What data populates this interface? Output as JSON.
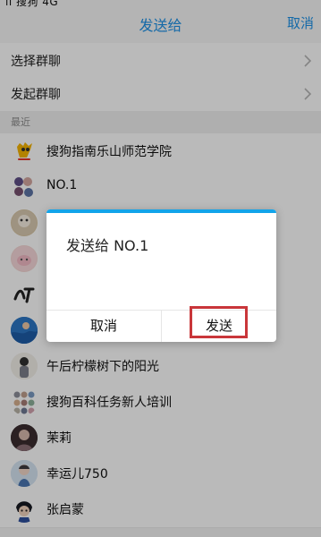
{
  "top_bar": {
    "status_fragment": "ıı 搜狗 4G",
    "title": "发送给",
    "cancel": "取消"
  },
  "actions": [
    {
      "label": "选择群聊"
    },
    {
      "label": "发起群聊"
    }
  ],
  "section": {
    "label": "最近"
  },
  "contacts": [
    {
      "name": "搜狗指南乐山师范学院",
      "avatar": "sogou-logo"
    },
    {
      "name": "NO.1",
      "avatar": "group-avatar"
    },
    {
      "name": "",
      "avatar": "cartoon-avatar"
    },
    {
      "name": "",
      "avatar": "pig-avatar"
    },
    {
      "name": "",
      "avatar": "calligraphy-avatar"
    },
    {
      "name": "",
      "avatar": "sea-avatar"
    },
    {
      "name": "午后柠檬树下的阳光",
      "avatar": "portrait-avatar"
    },
    {
      "name": "搜狗百科任务新人培训",
      "avatar": "group-avatar"
    },
    {
      "name": "茉莉",
      "avatar": "portrait-avatar"
    },
    {
      "name": "幸运儿750",
      "avatar": "girl-avatar"
    },
    {
      "name": "张启蒙",
      "avatar": "anime-avatar"
    }
  ],
  "dialog": {
    "title": "发送给 NO.1",
    "cancel": "取消",
    "send": "发送",
    "accent_color": "#12a4ea",
    "highlight_color": "#c9363a"
  }
}
